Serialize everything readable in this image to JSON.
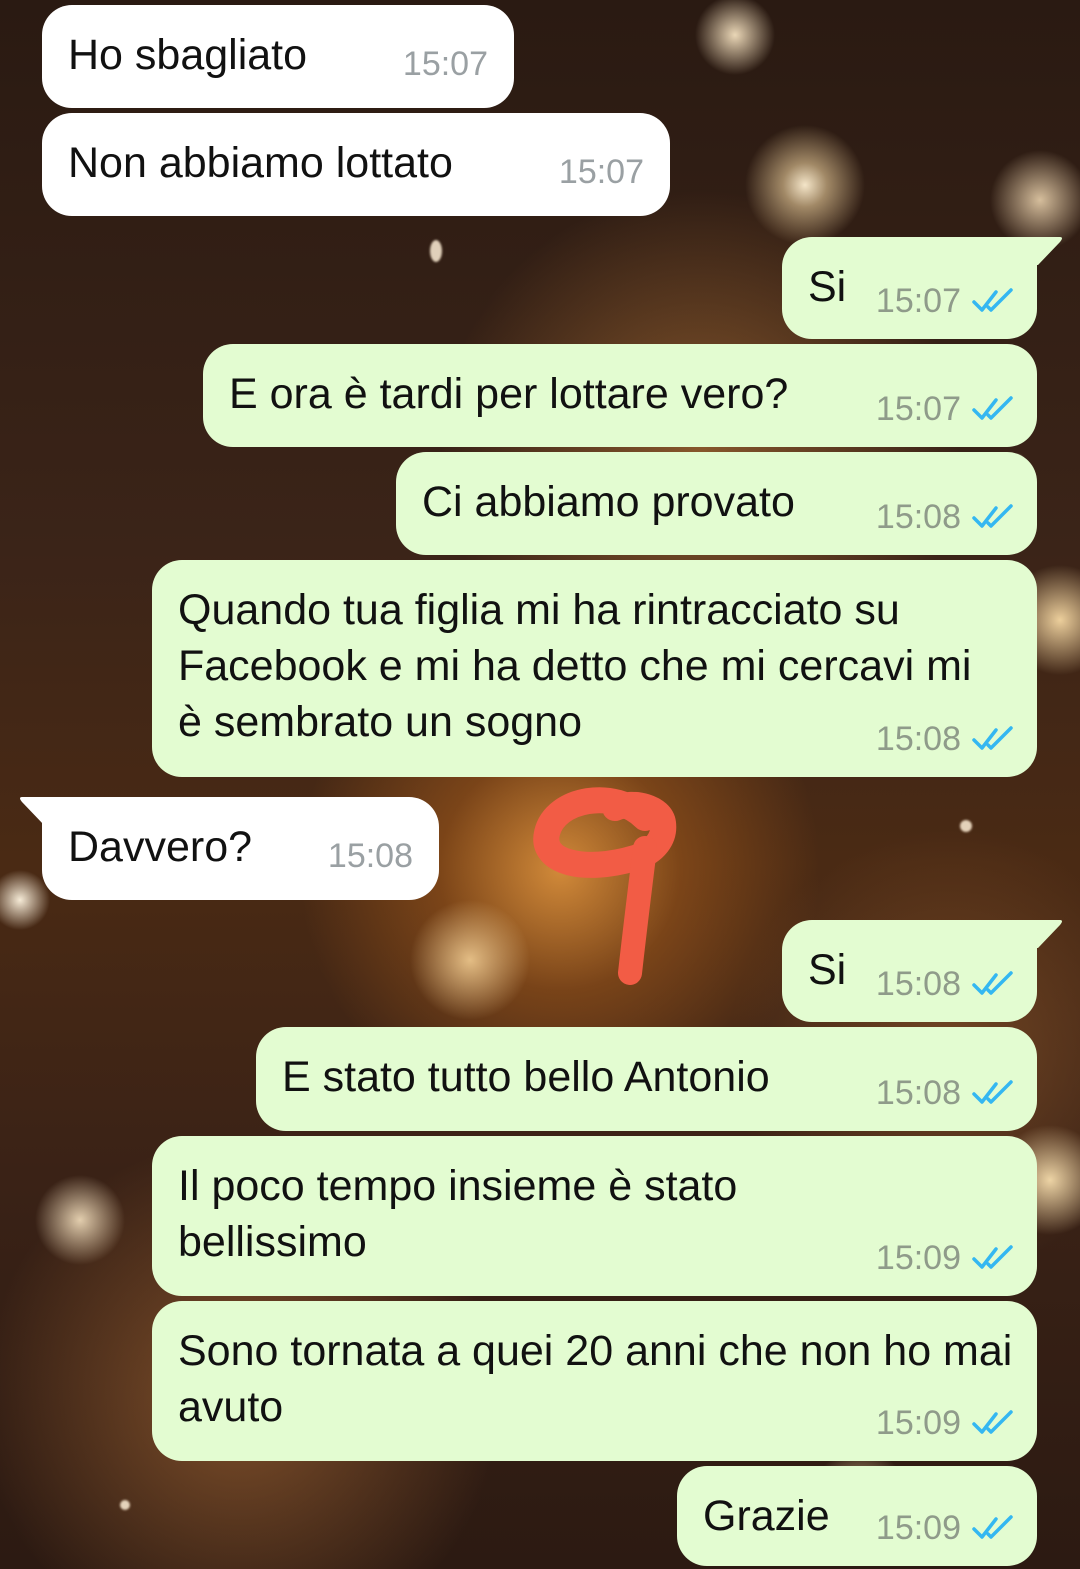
{
  "chat": {
    "messages": [
      {
        "side": "in",
        "text": "Ho sbagliato",
        "time": "15:07",
        "ticks": null
      },
      {
        "side": "in",
        "text": "Non abbiamo lottato",
        "time": "15:07",
        "ticks": null
      },
      {
        "side": "out",
        "text": "Si",
        "time": "15:07",
        "ticks": "read"
      },
      {
        "side": "out",
        "text": "E ora è tardi per lottare vero?",
        "time": "15:07",
        "ticks": "read"
      },
      {
        "side": "out",
        "text": "Ci abbiamo provato",
        "time": "15:08",
        "ticks": "read"
      },
      {
        "side": "out",
        "text": "Quando tua figlia mi ha rintracciato su Facebook e mi ha detto che mi cercavi mi è sembrato un sogno",
        "time": "15:08",
        "ticks": "read"
      },
      {
        "side": "in",
        "text": "Davvero?",
        "time": "15:08",
        "ticks": null
      },
      {
        "side": "out",
        "text": "Si",
        "time": "15:08",
        "ticks": "read"
      },
      {
        "side": "out",
        "text": "E stato tutto bello Antonio",
        "time": "15:08",
        "ticks": "read"
      },
      {
        "side": "out",
        "text": "Il poco tempo insieme è stato bellissimo",
        "time": "15:09",
        "ticks": "read"
      },
      {
        "side": "out",
        "text": "Sono tornata a quei 20 anni che non ho mai avuto",
        "time": "15:09",
        "ticks": "read"
      },
      {
        "side": "out",
        "text": "Grazie",
        "time": "15:09",
        "ticks": "read"
      }
    ]
  },
  "colors": {
    "incoming_bubble": "#ffffff",
    "outgoing_bubble": "#e3fcd1",
    "read_ticks": "#34b7f1",
    "annotation": "#f25c45"
  },
  "icons": {
    "read_receipt": "double-check-icon",
    "annotation": "hand-drawn-red-mark"
  }
}
